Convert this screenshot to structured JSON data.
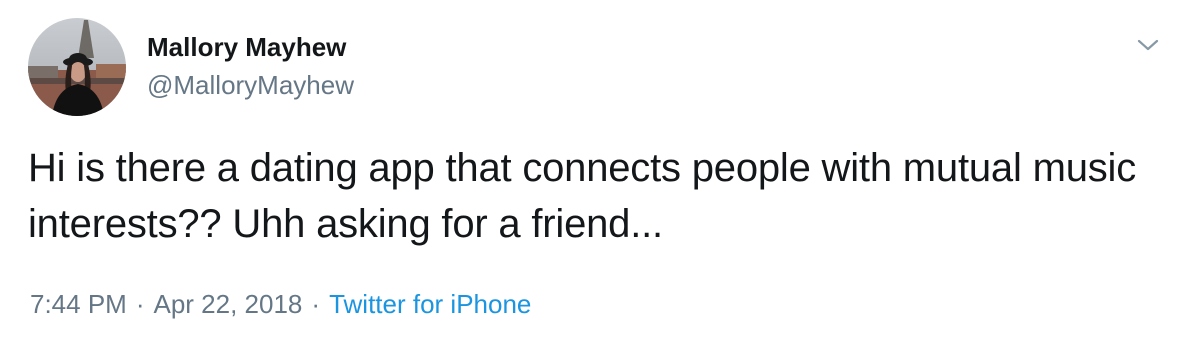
{
  "author": {
    "display_name": "Mallory Mayhew",
    "handle": "@MalloryMayhew"
  },
  "tweet": {
    "text": "Hi is there a dating app that connects people with mutual music interests?? Uhh asking for a friend...",
    "time": "7:44 PM",
    "separator": "·",
    "date": "Apr 22, 2018",
    "source": "Twitter for iPhone"
  },
  "icons": {
    "menu": "chevron-down-icon",
    "avatar": "profile-photo"
  },
  "colors": {
    "text": "#14171a",
    "secondary": "#657786",
    "link": "#1b95e0"
  }
}
